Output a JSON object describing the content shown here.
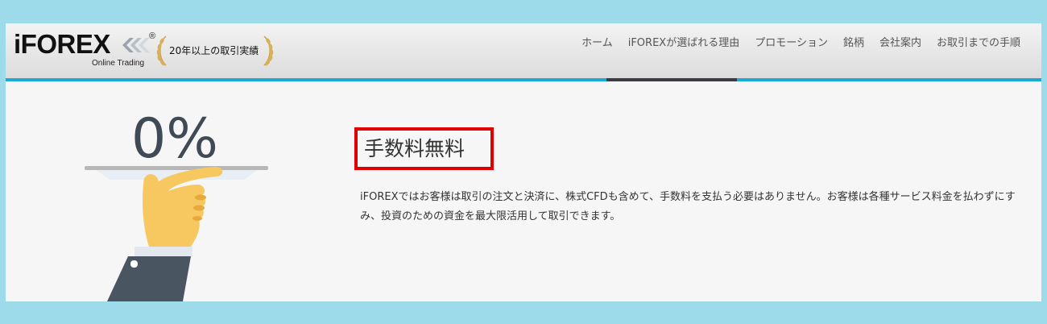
{
  "header": {
    "logo": {
      "brand": "iFOREX",
      "registered": "®",
      "tagline": "Online Trading",
      "award_text": "20年以上の取引実績"
    },
    "nav_items": [
      {
        "label": "ホーム"
      },
      {
        "label": "iFOREXが選ばれる理由"
      },
      {
        "label": "プロモーション"
      },
      {
        "label": "銘柄"
      },
      {
        "label": "会社案内"
      },
      {
        "label": "お取引までの手順"
      }
    ],
    "active_nav_index": 1
  },
  "feature": {
    "illustration_text": "0%",
    "title": "手数料無料",
    "description": "iFOREXではお客様は取引の注文と決済に、株式CFDも含めて、手数料を支払う必要はありません。お客様は各種サービス料金を払わずにすみ、投資のための資金を最大限活用して取引できます。"
  },
  "colors": {
    "background": "#9ddbea",
    "header_accent": "#1aaad3",
    "highlight_border": "#e00000",
    "hand": "#f6c85f",
    "sleeve": "#4a5562"
  },
  "icons": [
    "chevron-double-icon",
    "laurel-wreath-icon",
    "hand-tray-illustration"
  ]
}
